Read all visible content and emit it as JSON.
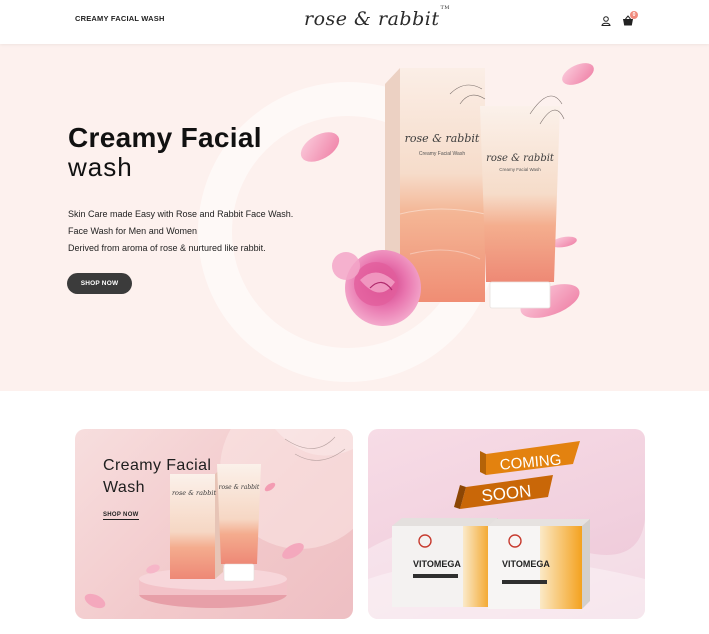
{
  "header": {
    "nav_link": "CREAMY FACIAL WASH",
    "logo": "rose & rabbit",
    "logo_tm": "TM",
    "cart_count": "0"
  },
  "hero": {
    "title_line1": "Creamy Facial",
    "title_line2": "wash",
    "lines": [
      "Skin Care made Easy with Rose and Rabbit Face Wash.",
      "Face Wash for Men and Women",
      "Derived from aroma of rose & nurtured like rabbit."
    ],
    "cta": "SHOP NOW",
    "package_brand": "rose & rabbit",
    "package_product": "Creamy Facial Wash"
  },
  "cards": [
    {
      "title_line1": "Creamy Facial",
      "title_line2": "Wash",
      "link": "SHOP NOW",
      "package_brand": "rose & rabbit"
    },
    {
      "banner_1": "COMING",
      "banner_2": "SOON",
      "product_name": "VITOMEGA"
    }
  ],
  "colors": {
    "hero_bg": "#fdf1ee",
    "accent_peach": "#f2a17e",
    "button_dark": "#3b3b3b",
    "banner_orange": "#d9770f"
  }
}
